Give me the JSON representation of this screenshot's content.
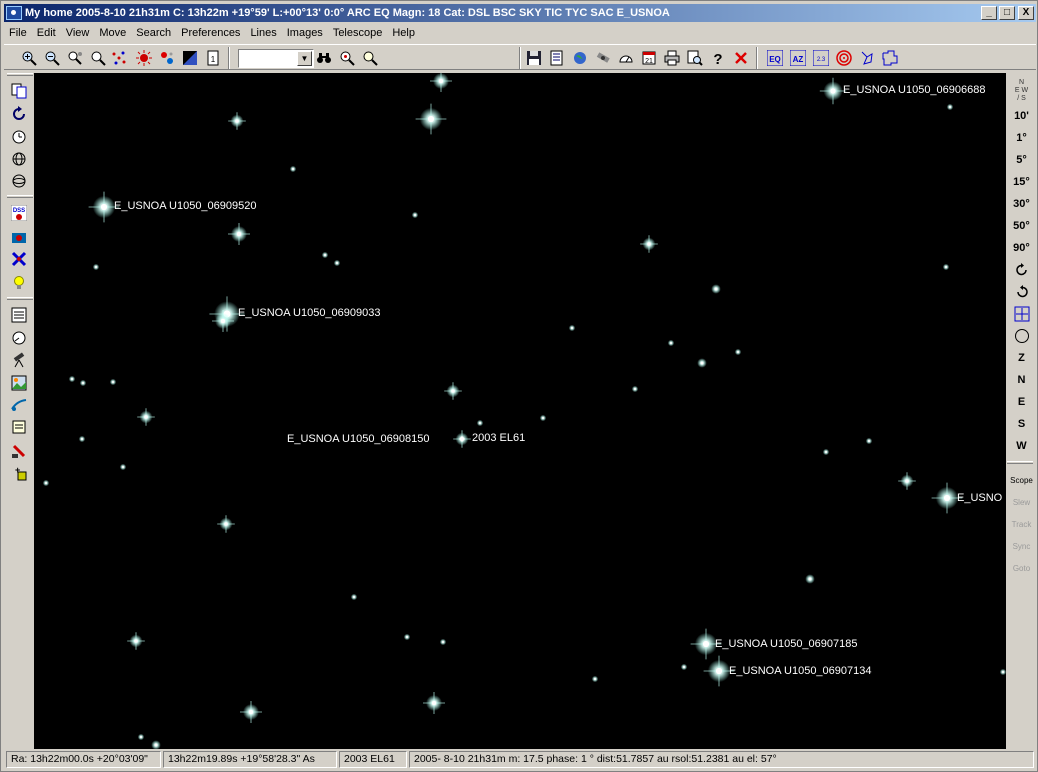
{
  "window": {
    "title": "My home 2005-8-10  21h31m C: 13h22m +19°59' L:+00°13' 0:0° ARC EQ Magn: 18 Cat: DSL BSC SKY TIC TYC SAC  E_USNOA",
    "min_label": "_",
    "max_label": "□",
    "close_label": "X"
  },
  "menu": [
    "File",
    "Edit",
    "View",
    "Move",
    "Search",
    "Preferences",
    "Lines",
    "Images",
    "Telescope",
    "Help"
  ],
  "toolbar": {
    "fov_value": "",
    "icons": [
      "zoom-in-icon",
      "zoom-out-icon",
      "zoom-fov-icon",
      "find-icon",
      "constellation-icon",
      "eclipse-icon",
      "planets-icon",
      "palette-icon",
      "page-icon",
      "binoculars-icon",
      "search-star-icon",
      "magnify-icon",
      "save-icon",
      "report-icon",
      "globe-icon",
      "satellite-icon",
      "gauge-icon",
      "calendar-icon",
      "print-icon",
      "zoom-page-icon",
      "help-icon",
      "close-red-icon",
      "eq-grid-icon",
      "az-grid-icon",
      "ecl-grid-icon",
      "target-icon",
      "constellation-lines-icon",
      "boundaries-icon"
    ],
    "eq_label": "EQ",
    "az_label": "AZ",
    "ecl_label": "2.3"
  },
  "right_toolbar": {
    "compass": "N\nE W\n/ S",
    "fov_buttons": [
      "10'",
      "1°",
      "5°",
      "15°",
      "30°",
      "50°",
      "90°"
    ],
    "directions": [
      "Z",
      "N",
      "E",
      "S",
      "W"
    ],
    "scope": [
      "Scope",
      "Slew",
      "Track",
      "Sync",
      "Goto"
    ]
  },
  "sky": {
    "labels": [
      {
        "text": "E_USNOA U1050_06906688"
      },
      {
        "text": "E_USNOA U1050_06909520"
      },
      {
        "text": "E_USNOA U1050_06909033"
      },
      {
        "text": "E_USNOA U1050_06908150"
      },
      {
        "text": "2003 EL61"
      },
      {
        "text": "E_USNOA U1050_06907185"
      },
      {
        "text": "E_USNOA U1050_06907134"
      },
      {
        "text": "E_USNO"
      }
    ]
  },
  "status": {
    "ra": "Ra: 13h22m00.0s +20°03'09\"",
    "coords": "13h22m19.89s +19°58'28.3\"  As",
    "object": "2003 EL61",
    "info": "2005- 8-10  21h31m m: 17.5 phase:  1 ° dist:51.7857 au rsol:51.2381 au el: 57°"
  }
}
